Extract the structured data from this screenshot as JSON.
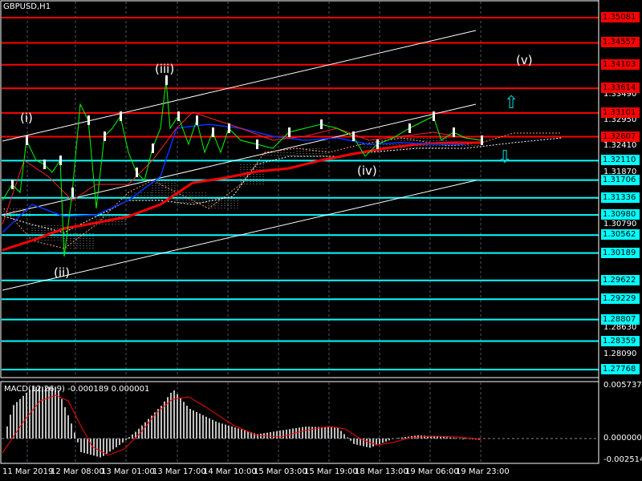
{
  "header": {
    "title": "GBPUSD,H1"
  },
  "levels": {
    "red": [
      "1.35081",
      "1.34557",
      "1.34103",
      "1.33614",
      "1.33101",
      "1.32607"
    ],
    "cyan": [
      "1.32110",
      "1.31706",
      "1.31336",
      "1.30980",
      "1.30562",
      "1.30189",
      "1.29622",
      "1.29229",
      "1.28807",
      "1.28359",
      "1.27768"
    ]
  },
  "price_axis": [
    "1.33490",
    "1.32950",
    "1.32410",
    "1.31870",
    "1.30790",
    "1.28630",
    "1.28090"
  ],
  "waves": {
    "i": "(i)",
    "ii": "(ii)",
    "iii": "(iii)",
    "iv": "(iv)",
    "v": "(v)"
  },
  "macd": {
    "label": "MACD(12,26,9) -0.000189 0.000001",
    "axis": [
      "0.005737",
      "0.000000",
      "-0.002514"
    ]
  },
  "time_axis": [
    "11 Mar 2019",
    "12 Mar 08:00",
    "13 Mar 01:00",
    "13 Mar 17:00",
    "14 Mar 10:00",
    "15 Mar 03:00",
    "15 Mar 19:00",
    "18 Mar 13:00",
    "19 Mar 06:00",
    "19 Mar 23:00"
  ],
  "colors": {
    "red_level": "#ff0000",
    "cyan_level": "#00ffff",
    "price": "#00ff00",
    "macd_signal": "#ff0000",
    "macd_hist": "#c0c0c0"
  }
}
